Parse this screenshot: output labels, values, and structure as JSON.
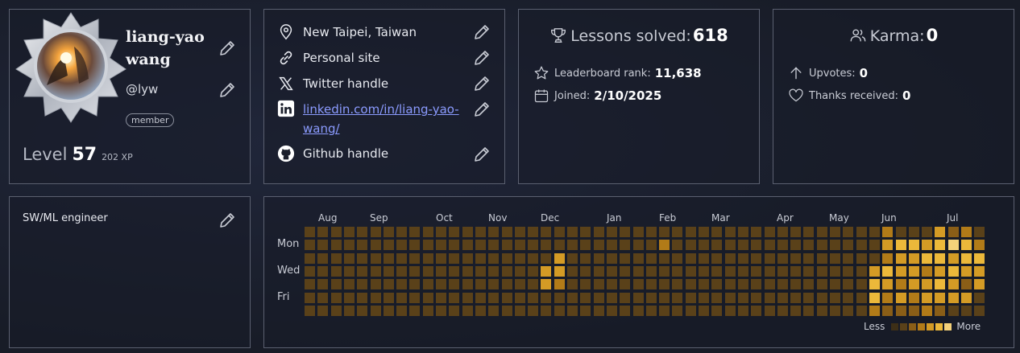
{
  "profile": {
    "name": "liang-yao wang",
    "handle": "@lyw",
    "badge": "member",
    "level_label": "Level",
    "level": "57",
    "xp": "202 XP"
  },
  "links": [
    {
      "icon": "location-pin-icon",
      "text": "New Taipei, Taiwan",
      "is_link": false
    },
    {
      "icon": "chain-link-icon",
      "text": "Personal site",
      "is_link": false
    },
    {
      "icon": "x-logo-icon",
      "text": "Twitter handle",
      "is_link": false
    },
    {
      "icon": "linkedin-logo-icon",
      "text": "linkedin.com/in/liang-yao-wang/",
      "is_link": true
    },
    {
      "icon": "github-logo-icon",
      "text": "Github handle",
      "is_link": false
    }
  ],
  "lessons": {
    "label": "Lessons solved:",
    "value": "618",
    "rank_label": "Leaderboard rank:",
    "rank": "11,638",
    "joined_label": "Joined:",
    "joined": "2/10/2025"
  },
  "karma": {
    "label": "Karma:",
    "value": "0",
    "upvotes_label": "Upvotes:",
    "upvotes": "0",
    "thanks_label": "Thanks received:",
    "thanks": "0"
  },
  "bio": {
    "text": "SW/ML engineer"
  },
  "activity": {
    "months": [
      "Aug",
      "Sep",
      "Oct",
      "Nov",
      "Dec",
      "Jan",
      "Feb",
      "Mar",
      "Apr",
      "May",
      "Jun",
      "Jul"
    ],
    "days": [
      "Mon",
      "Wed",
      "Fri"
    ],
    "legend_less": "Less",
    "legend_more": "More",
    "colors": [
      "#3d2f17",
      "#5a4119",
      "#8a5e17",
      "#b27b18",
      "#d49b25",
      "#ecb83a",
      "#f5d27a"
    ],
    "weeks": 52,
    "active_cells": [
      {
        "week": 27,
        "day": 1,
        "level": 3
      },
      {
        "week": 19,
        "day": 2,
        "level": 4
      },
      {
        "week": 18,
        "day": 3,
        "level": 4
      },
      {
        "week": 19,
        "day": 3,
        "level": 4
      },
      {
        "week": 18,
        "day": 4,
        "level": 4
      },
      {
        "week": 19,
        "day": 4,
        "level": 3
      },
      {
        "week": 44,
        "day": 0,
        "level": 3
      },
      {
        "week": 48,
        "day": 0,
        "level": 4
      },
      {
        "week": 49,
        "day": 0,
        "level": 2
      },
      {
        "week": 50,
        "day": 0,
        "level": 3
      },
      {
        "week": 44,
        "day": 1,
        "level": 4
      },
      {
        "week": 45,
        "day": 1,
        "level": 5
      },
      {
        "week": 46,
        "day": 1,
        "level": 5
      },
      {
        "week": 47,
        "day": 1,
        "level": 4
      },
      {
        "week": 48,
        "day": 1,
        "level": 5
      },
      {
        "week": 49,
        "day": 1,
        "level": 6
      },
      {
        "week": 50,
        "day": 1,
        "level": 5
      },
      {
        "week": 51,
        "day": 1,
        "level": 3
      },
      {
        "week": 44,
        "day": 2,
        "level": 3
      },
      {
        "week": 45,
        "day": 2,
        "level": 4
      },
      {
        "week": 46,
        "day": 2,
        "level": 4
      },
      {
        "week": 47,
        "day": 2,
        "level": 5
      },
      {
        "week": 48,
        "day": 2,
        "level": 5
      },
      {
        "week": 49,
        "day": 2,
        "level": 4
      },
      {
        "week": 50,
        "day": 2,
        "level": 5
      },
      {
        "week": 51,
        "day": 2,
        "level": 5
      },
      {
        "week": 43,
        "day": 3,
        "level": 4
      },
      {
        "week": 44,
        "day": 3,
        "level": 5
      },
      {
        "week": 45,
        "day": 3,
        "level": 4
      },
      {
        "week": 46,
        "day": 3,
        "level": 4
      },
      {
        "week": 47,
        "day": 3,
        "level": 3
      },
      {
        "week": 48,
        "day": 3,
        "level": 4
      },
      {
        "week": 49,
        "day": 3,
        "level": 5
      },
      {
        "week": 50,
        "day": 3,
        "level": 4
      },
      {
        "week": 51,
        "day": 3,
        "level": 4
      },
      {
        "week": 43,
        "day": 4,
        "level": 5
      },
      {
        "week": 44,
        "day": 4,
        "level": 4
      },
      {
        "week": 45,
        "day": 4,
        "level": 3
      },
      {
        "week": 46,
        "day": 4,
        "level": 4
      },
      {
        "week": 47,
        "day": 4,
        "level": 4
      },
      {
        "week": 48,
        "day": 4,
        "level": 5
      },
      {
        "week": 49,
        "day": 4,
        "level": 4
      },
      {
        "week": 50,
        "day": 4,
        "level": 2
      },
      {
        "week": 51,
        "day": 4,
        "level": 4
      },
      {
        "week": 43,
        "day": 5,
        "level": 5
      },
      {
        "week": 44,
        "day": 5,
        "level": 3
      },
      {
        "week": 45,
        "day": 5,
        "level": 4
      },
      {
        "week": 46,
        "day": 5,
        "level": 3
      },
      {
        "week": 47,
        "day": 5,
        "level": 4
      },
      {
        "week": 48,
        "day": 5,
        "level": 4
      },
      {
        "week": 49,
        "day": 5,
        "level": 4
      },
      {
        "week": 50,
        "day": 5,
        "level": 4
      },
      {
        "week": 43,
        "day": 6,
        "level": 3
      },
      {
        "week": 44,
        "day": 6,
        "level": 2
      },
      {
        "week": 45,
        "day": 6,
        "level": 2
      },
      {
        "week": 46,
        "day": 6,
        "level": 2
      },
      {
        "week": 47,
        "day": 6,
        "level": 3
      },
      {
        "week": 48,
        "day": 6,
        "level": 2
      }
    ]
  }
}
